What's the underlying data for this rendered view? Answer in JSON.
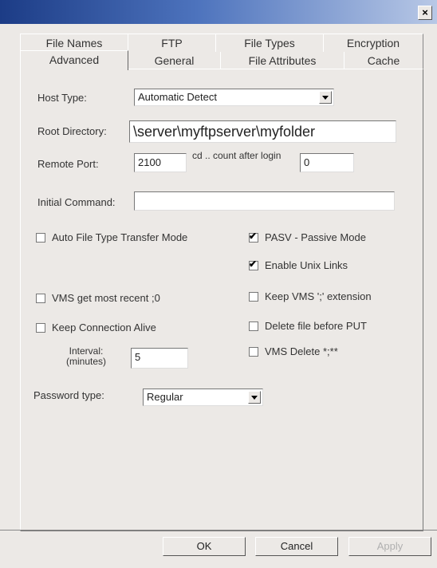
{
  "window": {
    "close_label": "×"
  },
  "tabs_row1": [
    "File Names",
    "FTP",
    "File Types",
    "Encryption"
  ],
  "tabs_row2": [
    "Advanced",
    "General",
    "File Attributes",
    "Cache"
  ],
  "form": {
    "host_type_label": "Host Type:",
    "host_type_value": "Automatic Detect",
    "root_dir_label": "Root Directory:",
    "root_dir_value": "\\server\\myftpserver\\myfolder",
    "remote_port_label": "Remote Port:",
    "remote_port_value": "2100",
    "cd_count_label": "cd .. count after login",
    "cd_count_value": "0",
    "initial_command_label": "Initial Command:",
    "initial_command_value": "",
    "interval_label": "Interval: (minutes)",
    "interval_value": "5",
    "password_type_label": "Password type:",
    "password_type_value": "Regular"
  },
  "checkboxes": {
    "auto_file_type": {
      "label": "Auto File Type Transfer Mode",
      "checked": false
    },
    "pasv": {
      "label": "PASV - Passive Mode",
      "checked": true
    },
    "unix_links": {
      "label": "Enable Unix Links",
      "checked": true
    },
    "vms_recent": {
      "label": "VMS get most recent ;0",
      "checked": false
    },
    "keep_vms_ext": {
      "label": "Keep VMS ';' extension",
      "checked": false
    },
    "keep_alive": {
      "label": "Keep Connection Alive",
      "checked": false
    },
    "delete_before_put": {
      "label": "Delete file before PUT",
      "checked": false
    },
    "vms_delete": {
      "label": "VMS Delete *;**",
      "checked": false
    }
  },
  "buttons": {
    "ok": "OK",
    "cancel": "Cancel",
    "apply": "Apply"
  }
}
